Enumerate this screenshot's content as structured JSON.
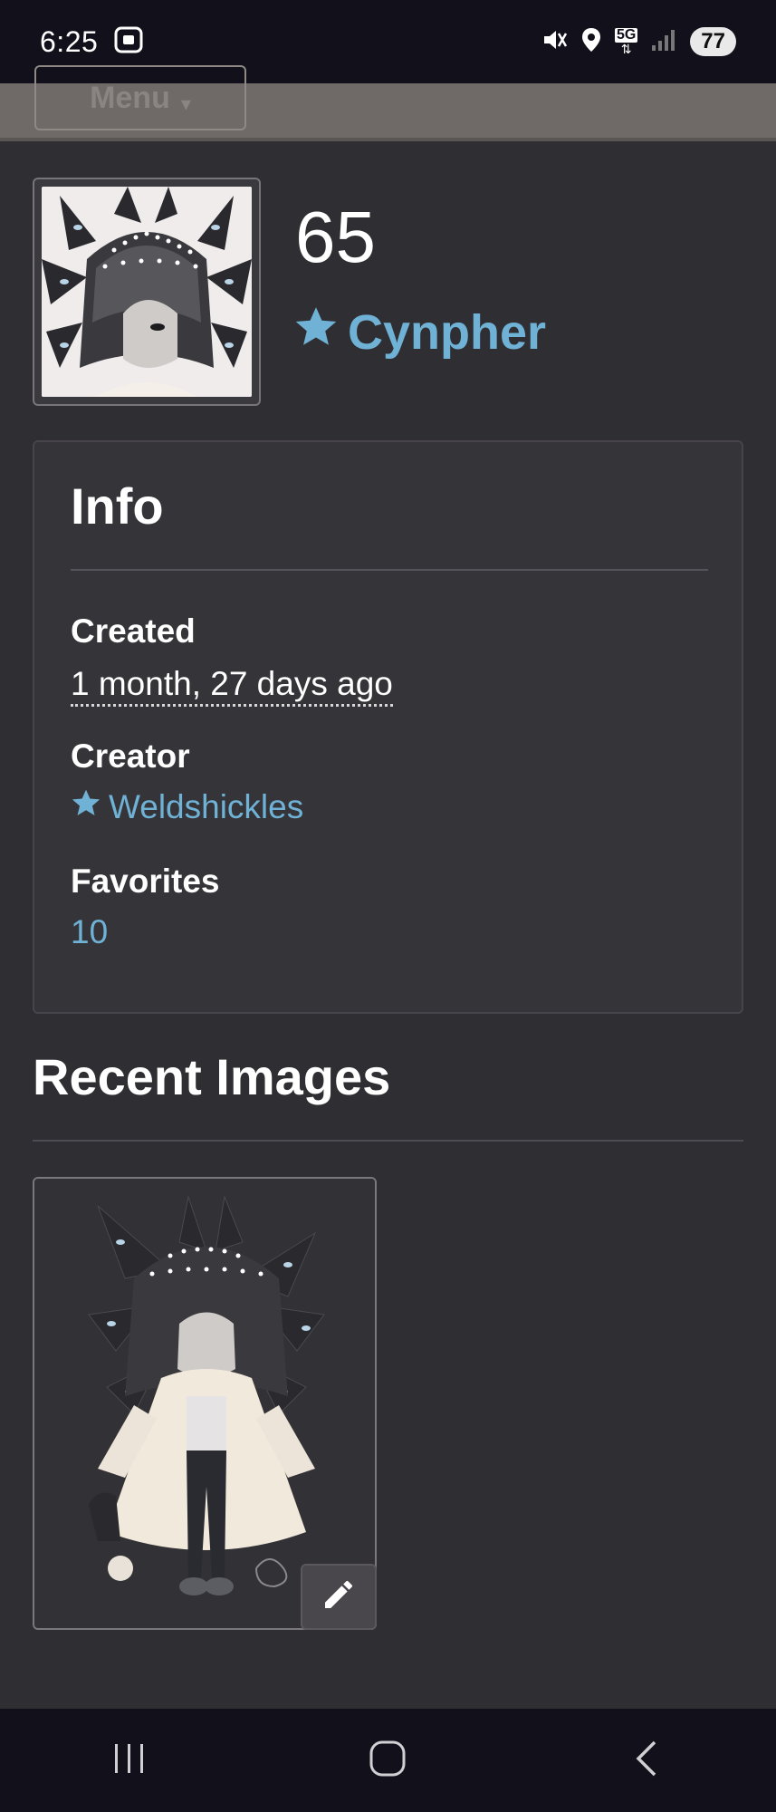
{
  "status_bar": {
    "time": "6:25",
    "battery": "77",
    "network": "5G"
  },
  "nav": {
    "menu_label": "Menu"
  },
  "character": {
    "id": "65",
    "name": "Cynpher",
    "name_color": "#6fb2d6",
    "star_icon": "star-icon"
  },
  "info": {
    "title": "Info",
    "created_label": "Created",
    "created_value": "1 month, 27 days ago",
    "creator_label": "Creator",
    "creator_value": "Weldshickles",
    "favorites_label": "Favorites",
    "favorites_value": "10"
  },
  "recent_images": {
    "title": "Recent Images"
  },
  "colors": {
    "background": "#2f2e32",
    "panel": "#353438",
    "accent": "#6fb2d6",
    "system_bar": "#12111b"
  }
}
